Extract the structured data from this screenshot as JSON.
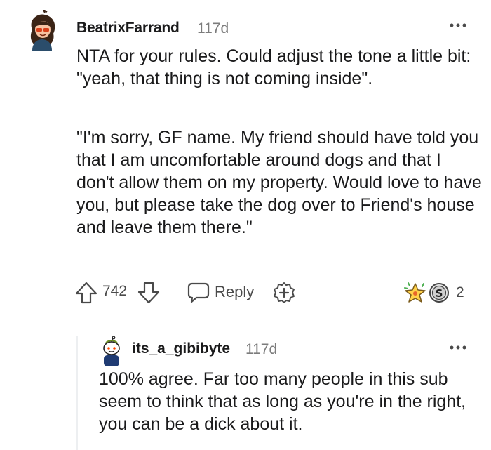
{
  "comment": {
    "username": "BeatrixFarrand",
    "timestamp": "117d",
    "paragraphs": [
      "NTA for your rules. Could adjust the tone a little bit: \"yeah, that thing is not coming inside\".",
      "\"I'm sorry, GF name. My friend should have told you that I am uncomfortable around dogs and that I don't allow them on my property. Would love to have you, but please take the dog over to Friend's house and leave them there.\""
    ],
    "score": "742",
    "reply_label": "Reply",
    "award_count": "2",
    "icons": {
      "upvote": "upvote-arrow-icon",
      "downvote": "downvote-arrow-icon",
      "reply": "speech-bubble-icon",
      "award": "plus-circle-icon",
      "more": "more-dots-icon"
    }
  },
  "reply": {
    "username": "its_a_gibibyte",
    "timestamp": "117d",
    "text": "100% agree. Far too many people in this sub seem to think that as long as you're in the right, you can be a dick about it."
  },
  "colors": {
    "text": "#1a1a1b",
    "muted": "#7c7c7c",
    "icon": "#4a4a4a",
    "thread_line": "#edeff1",
    "background": "#ffffff"
  }
}
